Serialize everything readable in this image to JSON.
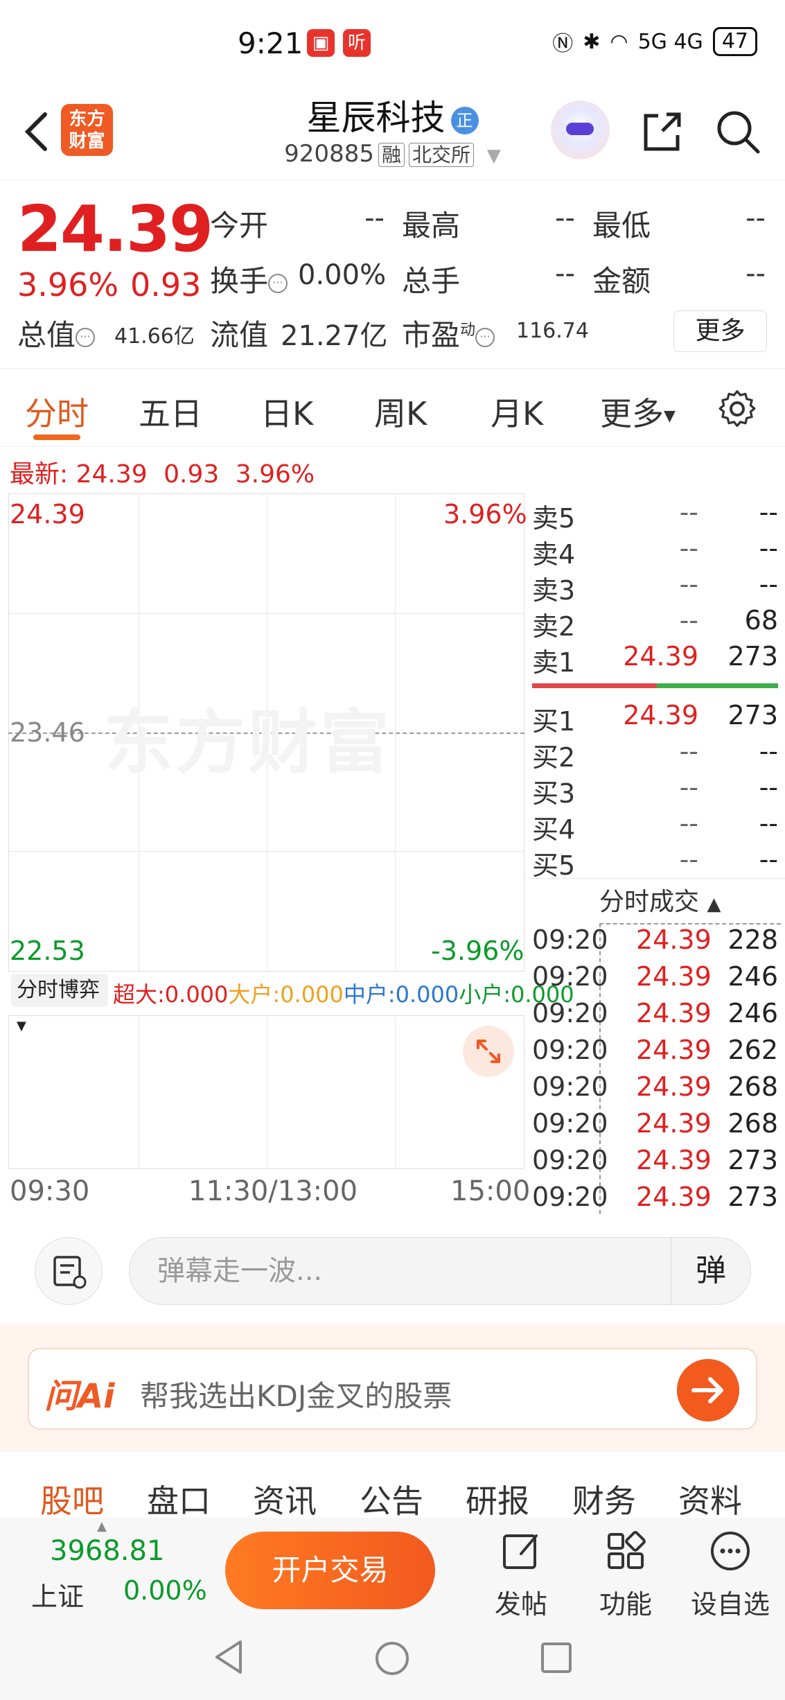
{
  "status_bar": {
    "time": "9:21",
    "app1": "▣",
    "app2": "听",
    "signal": "5G 4G",
    "battery": "47"
  },
  "header": {
    "logo_line1": "东方",
    "logo_line2": "财富",
    "title": "星辰科技",
    "title_badge": "正",
    "code": "920885",
    "tag1": "融",
    "tag2": "北交所"
  },
  "quote": {
    "price": "24.39",
    "change_pct": "3.96%",
    "change_amt": "0.93",
    "open_label": "今开",
    "open": "--",
    "high_label": "最高",
    "high": "--",
    "low_label": "最低",
    "low": "--",
    "turnover_label": "换手",
    "turnover": "0.00%",
    "vol_label": "总手",
    "vol": "--",
    "amount_label": "金额",
    "amount": "--",
    "mcap_label": "总值",
    "mcap": "41.66亿",
    "float_label": "流值",
    "float": "21.27亿",
    "pe_label": "市盈",
    "pe_sup": "动",
    "pe": "116.74",
    "more": "更多"
  },
  "tabs": [
    "分时",
    "五日",
    "日K",
    "周K",
    "月K",
    "更多"
  ],
  "latest": {
    "label": "最新:",
    "price": "24.39",
    "chg": "0.93",
    "pct": "3.96%"
  },
  "chart": {
    "y_top": "24.39",
    "y_mid": "23.46",
    "y_bottom": "22.53",
    "pct_top": "3.96%",
    "pct_bottom": "-3.96%",
    "watermark": "东方财富",
    "game_select": "分时博弈",
    "flows": {
      "super": "超大:0.000",
      "large": "大户:0.000",
      "mid": "中户:0.000",
      "small": "小户:0.000"
    },
    "times": [
      "09:30",
      "11:30/13:00",
      "15:00"
    ]
  },
  "order_book": {
    "asks": [
      {
        "label": "卖5",
        "price": "--",
        "vol": "--"
      },
      {
        "label": "卖4",
        "price": "--",
        "vol": "--"
      },
      {
        "label": "卖3",
        "price": "--",
        "vol": "--"
      },
      {
        "label": "卖2",
        "price": "--",
        "vol": "68"
      },
      {
        "label": "卖1",
        "price": "24.39",
        "vol": "273"
      }
    ],
    "bids": [
      {
        "label": "买1",
        "price": "24.39",
        "vol": "273"
      },
      {
        "label": "买2",
        "price": "--",
        "vol": "--"
      },
      {
        "label": "买3",
        "price": "--",
        "vol": "--"
      },
      {
        "label": "买4",
        "price": "--",
        "vol": "--"
      },
      {
        "label": "买5",
        "price": "--",
        "vol": "--"
      }
    ],
    "trades_title": "分时成交",
    "trades": [
      {
        "time": "09:20",
        "price": "24.39",
        "vol": "228"
      },
      {
        "time": "09:20",
        "price": "24.39",
        "vol": "246"
      },
      {
        "time": "09:20",
        "price": "24.39",
        "vol": "246"
      },
      {
        "time": "09:20",
        "price": "24.39",
        "vol": "262"
      },
      {
        "time": "09:20",
        "price": "24.39",
        "vol": "268"
      },
      {
        "time": "09:20",
        "price": "24.39",
        "vol": "268"
      },
      {
        "time": "09:20",
        "price": "24.39",
        "vol": "273"
      },
      {
        "time": "09:20",
        "price": "24.39",
        "vol": "273"
      }
    ]
  },
  "danmaku": {
    "placeholder": "弹幕走一波...",
    "button": "弹"
  },
  "ai": {
    "logo": "问Ai",
    "prompt": "帮我选出KDJ金叉的股票"
  },
  "bottom_tabs": [
    "股吧",
    "盘口",
    "资讯",
    "公告",
    "研报",
    "财务",
    "资料"
  ],
  "toolbar": {
    "index_value": "3968.81",
    "index_name": "上证",
    "index_change": "0.00%",
    "trade": "开户交易",
    "post": "发帖",
    "func": "功能",
    "watch": "设自选"
  },
  "colors": {
    "up": "#e02020",
    "down": "#0a9a2a",
    "accent": "#f05a24"
  }
}
